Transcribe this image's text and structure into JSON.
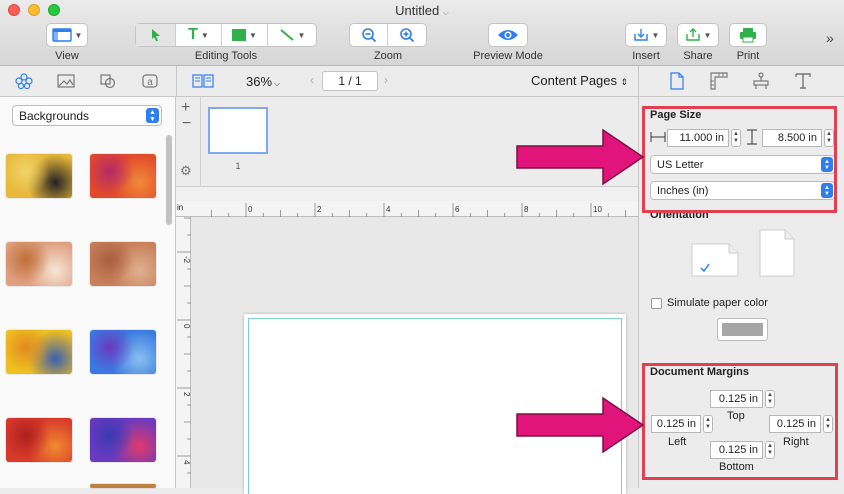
{
  "window": {
    "title": "Untitled"
  },
  "toolbar": {
    "view_label": "View",
    "editing_tools_label": "Editing Tools",
    "zoom_label": "Zoom",
    "preview_label": "Preview Mode",
    "insert_label": "Insert",
    "share_label": "Share",
    "print_label": "Print",
    "overflow": "»"
  },
  "subbar": {
    "zoom_value": "36%",
    "page_counter": "1 / 1",
    "content_pages": "Content Pages"
  },
  "sidebar": {
    "category": "Backgrounds",
    "thumbnails": [
      {
        "name": "thumb-yellow-black",
        "colors": [
          "#e8b83a",
          "#222222",
          "#f2d36a"
        ]
      },
      {
        "name": "thumb-red-orange",
        "colors": [
          "#e24a2a",
          "#f08a3a",
          "#b52a6a"
        ]
      },
      {
        "name": "thumb-orange-speckle",
        "colors": [
          "#e0a080",
          "#f5e6d8",
          "#c0703a"
        ]
      },
      {
        "name": "thumb-copper",
        "colors": [
          "#c8805a",
          "#e0b090",
          "#a86040"
        ]
      },
      {
        "name": "thumb-yellow-blue",
        "colors": [
          "#f0c020",
          "#3a5fb0",
          "#e08a20"
        ]
      },
      {
        "name": "thumb-blue-purple",
        "colors": [
          "#3a7ae0",
          "#8ac0f0",
          "#6a3ac0"
        ]
      },
      {
        "name": "thumb-red-gold",
        "colors": [
          "#d83a2a",
          "#f08a30",
          "#b02020"
        ]
      },
      {
        "name": "thumb-purple-red",
        "colors": [
          "#6a3ac0",
          "#e03a6a",
          "#3a3ab0"
        ]
      }
    ]
  },
  "pages": {
    "page1_number": "1"
  },
  "rulers": {
    "unit": "in",
    "h_ticks": [
      "0",
      "2",
      "4",
      "6",
      "8",
      "10"
    ],
    "v_ticks": [
      "-2",
      "0",
      "2",
      "4"
    ]
  },
  "inspector": {
    "page_size": {
      "title": "Page Size",
      "width": "11.000 in",
      "height": "8.500 in",
      "paper": "US Letter",
      "units": "Inches (in)"
    },
    "orientation": {
      "title": "Orientation"
    },
    "simulate_paper_color": "Simulate paper color",
    "paper_color": "#a6a6a6",
    "margins": {
      "title": "Document Margins",
      "top": "0.125 in",
      "top_label": "Top",
      "left": "0.125 in",
      "left_label": "Left",
      "right": "0.125 in",
      "right_label": "Right",
      "bottom": "0.125 in",
      "bottom_label": "Bottom"
    }
  },
  "colors": {
    "accent": "#2f7ef0",
    "highlight_box": "#e04050",
    "arrow": "#e0147a",
    "green": "#2fb04a"
  }
}
